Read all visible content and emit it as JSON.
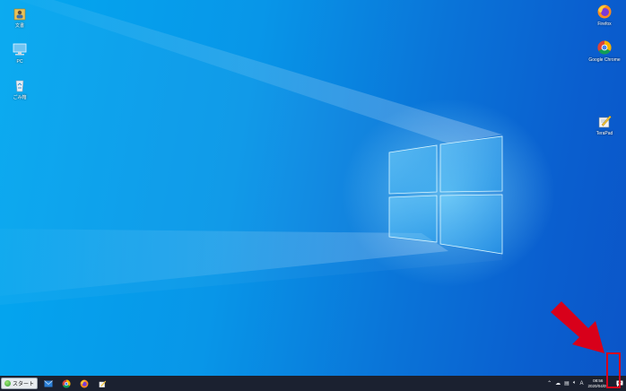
{
  "desktop": {
    "icons_left": [
      {
        "label": "文書",
        "icon": "user-folder-icon"
      },
      {
        "label": "PC",
        "icon": "this-pc-icon"
      },
      {
        "label": "ごみ箱",
        "icon": "recycle-bin-icon"
      }
    ],
    "icons_right": [
      {
        "label": "Firefox",
        "icon": "firefox-icon"
      },
      {
        "label": "Google Chrome",
        "icon": "chrome-icon"
      },
      {
        "label": "TeraPad",
        "icon": "terapad-icon"
      }
    ]
  },
  "taskbar": {
    "start_label": "スタート",
    "apps": [
      {
        "name": "mail-icon"
      },
      {
        "name": "chrome-icon"
      },
      {
        "name": "firefox-icon"
      },
      {
        "name": "terapad-icon"
      }
    ],
    "tray": {
      "ime_indicator": "A",
      "time": "08:56",
      "date": "2020/04/09"
    }
  },
  "annotation": {
    "highlight_color": "#d8001a",
    "target": "notification-center-button"
  },
  "colors": {
    "wallpaper_left": "#03a8f0",
    "wallpaper_right": "#0b55c8",
    "taskbar": "#1b2130"
  }
}
